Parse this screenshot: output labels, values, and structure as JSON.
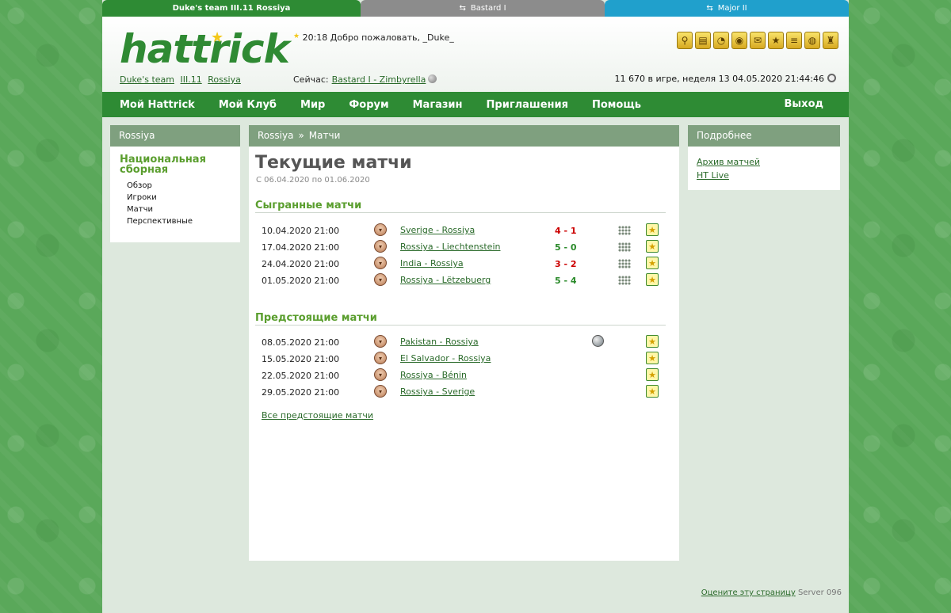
{
  "team_tabs": [
    {
      "label": "Duke's team III.11 Rossiya"
    },
    {
      "label": "Bastard I"
    },
    {
      "label": "Major II"
    }
  ],
  "header": {
    "logo": "hattrick",
    "team_link": "Duke's team",
    "league_link": "III.11",
    "country_link": "Rossiya",
    "welcome": "20:18 Добро пожаловать, _Duke_",
    "now_label": "Сейчас:",
    "now_link": "Bastard I - Zimbyrella",
    "status": "11 670 в игре, неделя 13  04.05.2020 21:44:46"
  },
  "nav": {
    "items": [
      "Мой Hattrick",
      "Мой Клуб",
      "Мир",
      "Форум",
      "Магазин",
      "Приглашения",
      "Помощь"
    ],
    "logout": "Выход"
  },
  "left": {
    "title": "Rossiya",
    "section": "Национальная сборная",
    "items": [
      "Обзор",
      "Игроки",
      "Матчи",
      "Перспективные"
    ]
  },
  "center": {
    "crumb1": "Rossiya",
    "crumb_sep": "»",
    "crumb2": "Матчи",
    "title": "Текущие матчи",
    "date_range": "С 06.04.2020 по 01.06.2020",
    "played_title": "Сыгранные матчи",
    "played": [
      {
        "date": "10.04.2020 21:00",
        "teams": "Sverige - Rossiya",
        "score": "4 - 1",
        "result": "loss"
      },
      {
        "date": "17.04.2020 21:00",
        "teams": "Rossiya - Liechtenstein",
        "score": "5 - 0",
        "result": "win"
      },
      {
        "date": "24.04.2020 21:00",
        "teams": "India - Rossiya",
        "score": "3 - 2",
        "result": "loss"
      },
      {
        "date": "01.05.2020 21:00",
        "teams": "Rossiya - Lëtzebuerg",
        "score": "5 - 4",
        "result": "win"
      }
    ],
    "upcoming_title": "Предстоящие матчи",
    "upcoming": [
      {
        "date": "08.05.2020 21:00",
        "teams": "Pakistan - Rossiya",
        "live": true
      },
      {
        "date": "15.05.2020 21:00",
        "teams": "El Salvador - Rossiya",
        "live": false
      },
      {
        "date": "22.05.2020 21:00",
        "teams": "Rossiya - Bénin",
        "live": false
      },
      {
        "date": "29.05.2020 21:00",
        "teams": "Rossiya - Sverige",
        "live": false
      }
    ],
    "all_upcoming": "Все предстоящие матчи"
  },
  "right": {
    "title": "Подробнее",
    "links": [
      "Архив матчей",
      "HT Live"
    ]
  },
  "footer": {
    "rate_link": "Оцените эту страницу",
    "server": "Server 096"
  },
  "colors": {
    "brand_green": "#2e8b34",
    "box_header": "#7fa07f",
    "section_green": "#5a9e2e",
    "loss_red": "#cc0000",
    "win_green": "#2a8a2a"
  },
  "toolbar_icons": [
    "search-icon",
    "ticket-icon",
    "whistle-icon",
    "medal-icon",
    "mail-icon",
    "star-note-icon",
    "notes-icon",
    "trophy-icon",
    "spy-icon"
  ]
}
